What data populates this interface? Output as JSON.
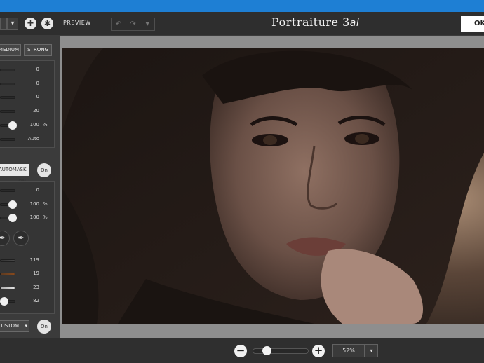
{
  "header": {
    "preview_label": "PREVIEW",
    "title_main": "Portraiture 3",
    "title_suffix": "ai",
    "ok_label": "OK",
    "dropdown_icon": "chevron-down-icon",
    "add_icon": "plus-icon",
    "settings_icon": "gear-icon",
    "undo_icon": "undo-icon",
    "redo_icon": "redo-icon"
  },
  "smoothing": {
    "medium_label": "MEDIUM",
    "strong_label": "STRONG",
    "values": [
      "0",
      "0",
      "0",
      "20",
      "100",
      "Auto"
    ],
    "percent": "%"
  },
  "skin_mask": {
    "automask_label": "AUTOMASK ON",
    "on_label": "On",
    "values": [
      "0",
      "100",
      "100"
    ],
    "percent": "%",
    "hue_values": [
      "119",
      "19",
      "23",
      "82"
    ]
  },
  "enhancements": {
    "preset_label": "CUSTOM",
    "on_label": "On"
  },
  "zoom": {
    "minus": "−",
    "plus": "+",
    "value": "52%",
    "level": 0.25
  },
  "colors": {
    "titlebar": "#1e7fd4",
    "swatch_1": "#4b4b4b",
    "swatch_2": "#8a4a1c",
    "swatch_3": "#d9d9d9"
  }
}
